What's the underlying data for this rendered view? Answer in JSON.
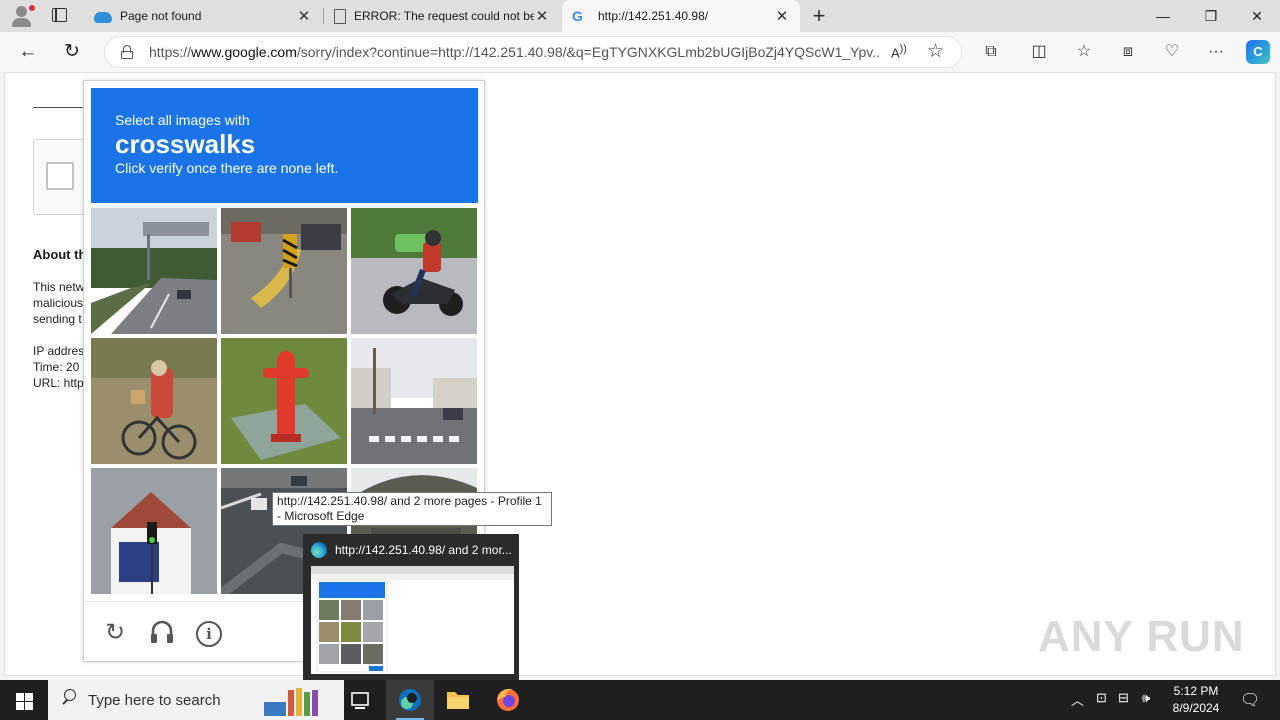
{
  "browser": {
    "tabs": [
      {
        "title": "Page not found",
        "favicon": "cloud-icon"
      },
      {
        "title": "ERROR: The request could not be satisfied",
        "favicon": "document-icon"
      },
      {
        "title": "http://142.251.40.98/",
        "favicon": "google-icon",
        "active": true
      }
    ],
    "address": {
      "prefix": "https://",
      "domain": "www.google.com",
      "rest": "/sorry/index?continue=http://142.251.40.98/&q=EgTYGNXKGLmb2bUGIjBoZj4YQScW1_Ypv..."
    }
  },
  "page": {
    "about_heading": "About th",
    "para1": [
      "This netw",
      "malicious",
      "sending t"
    ],
    "para2": [
      "IP addres",
      "Time: 20",
      "URL: http"
    ]
  },
  "captcha": {
    "instruction": "Select all images with",
    "target": "crosswalks",
    "hint": "Click verify once there are none left.",
    "footer_icons": [
      "reload-icon",
      "audio-icon",
      "info-icon"
    ]
  },
  "tooltip": {
    "text": "http://142.251.40.98/ and 2 more pages - Profile 1 - Microsoft Edge"
  },
  "thumbnail": {
    "title": "http://142.251.40.98/ and 2 mor..."
  },
  "watermark": "ANY RUN",
  "taskbar": {
    "search_placeholder": "Type here to search",
    "time": "5:12 PM",
    "date": "8/9/2024"
  }
}
